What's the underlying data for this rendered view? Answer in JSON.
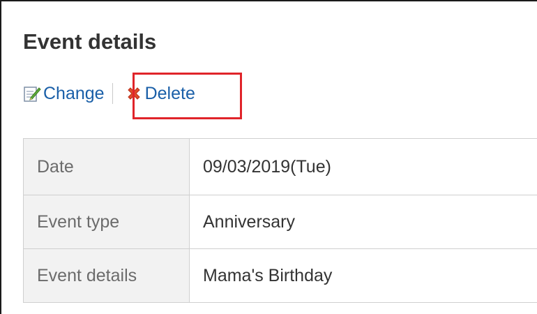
{
  "page": {
    "title": "Event details"
  },
  "toolbar": {
    "change_label": "Change",
    "change_icon": "edit-icon",
    "delete_label": "Delete",
    "delete_icon": "delete-x-icon",
    "highlight_color": "#e0242a"
  },
  "details": {
    "rows": [
      {
        "label": "Date",
        "value": "09/03/2019(Tue)"
      },
      {
        "label": "Event type",
        "value": "Anniversary"
      },
      {
        "label": "Event details",
        "value": "Mama's Birthday"
      }
    ]
  }
}
